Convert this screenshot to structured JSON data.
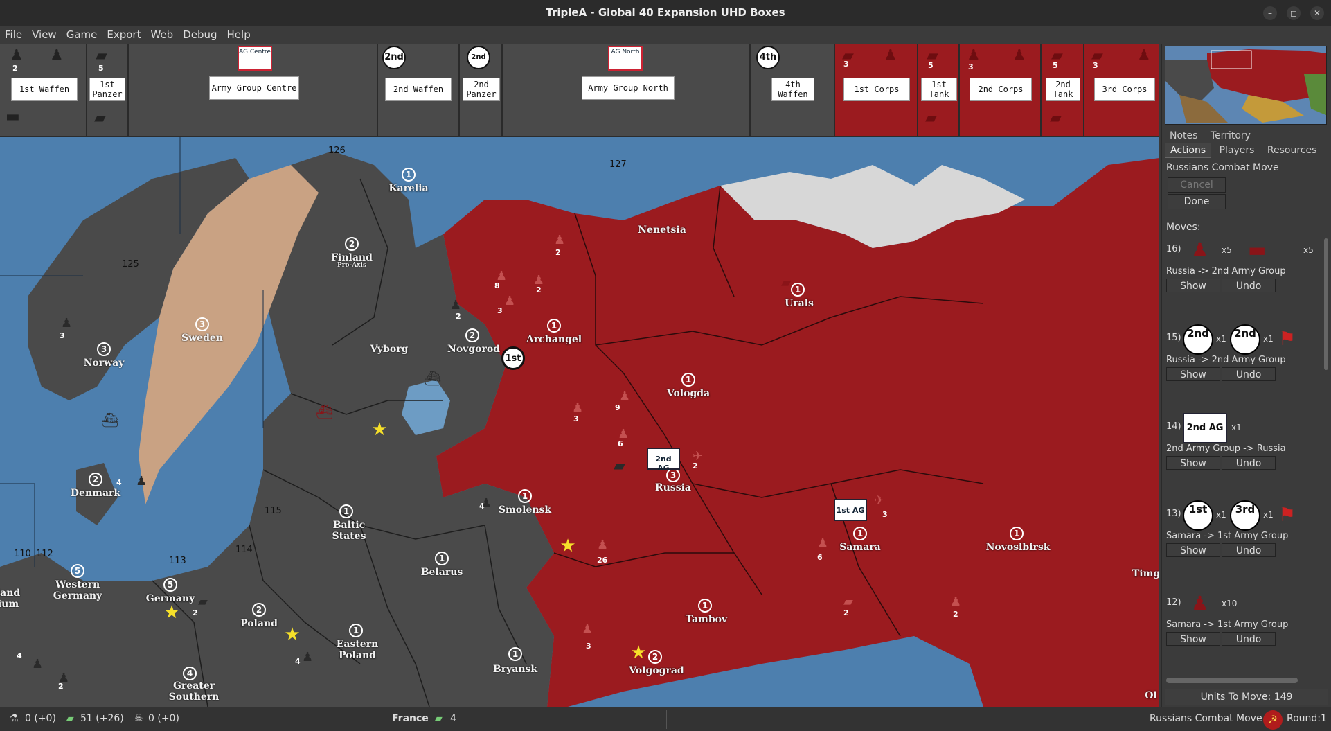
{
  "window": {
    "title": "TripleA - Global 40 Expansion UHD Boxes",
    "controls": [
      "–",
      "◻",
      "✕"
    ]
  },
  "menu": [
    "File",
    "View",
    "Game",
    "Export",
    "Web",
    "Debug",
    "Help"
  ],
  "unit_strip": {
    "groups": [
      {
        "labels": [
          "1st Waffen"
        ],
        "counts": [
          "2"
        ]
      },
      {
        "labels": [
          "1st Panzer"
        ],
        "counts": [
          "5"
        ]
      },
      {
        "labels": [
          "Army Group Centre"
        ],
        "badge": "AG Centre"
      },
      {
        "labels": [
          "2nd Waffen"
        ],
        "badge": "2nd"
      },
      {
        "labels": [
          "2nd Panzer"
        ],
        "badge": "2nd"
      },
      {
        "labels": [
          "Army Group North"
        ],
        "badge": "AG North"
      },
      {
        "labels": [
          "4th Waffen"
        ],
        "badge": "4th"
      },
      {
        "labels": [
          "1st Corps"
        ],
        "counts": [
          "3"
        ]
      },
      {
        "labels": [
          "1st Tank"
        ],
        "counts": [
          "5"
        ]
      },
      {
        "labels": [
          "2nd Corps"
        ],
        "counts": [
          "3"
        ]
      },
      {
        "labels": [
          "2nd Tank"
        ],
        "counts": [
          "5"
        ]
      },
      {
        "labels": [
          "3rd Corps"
        ],
        "counts": [
          "3"
        ]
      }
    ]
  },
  "map": {
    "sea_zones": [
      "126",
      "127",
      "125",
      "115",
      "110",
      "112",
      "113",
      "114"
    ],
    "territories": [
      {
        "name": "Karelia",
        "ipc": "1"
      },
      {
        "name": "Finland",
        "ipc": "2",
        "sub": "Pro-Axis"
      },
      {
        "name": "Sweden",
        "ipc": "3"
      },
      {
        "name": "Norway",
        "ipc": "3"
      },
      {
        "name": "Vyborg",
        "ipc": ""
      },
      {
        "name": "Novgorod",
        "ipc": "2"
      },
      {
        "name": "Archangel",
        "ipc": "1"
      },
      {
        "name": "Nenetsia",
        "ipc": ""
      },
      {
        "name": "Urals",
        "ipc": "1"
      },
      {
        "name": "Vologda",
        "ipc": "1"
      },
      {
        "name": "Russia",
        "ipc": "3"
      },
      {
        "name": "Denmark",
        "ipc": "2"
      },
      {
        "name": "Smolensk",
        "ipc": "1"
      },
      {
        "name": "Baltic States",
        "ipc": "1"
      },
      {
        "name": "Belarus",
        "ipc": "1"
      },
      {
        "name": "Western Germany",
        "ipc": "5"
      },
      {
        "name": "Germany",
        "ipc": "5"
      },
      {
        "name": "Poland",
        "ipc": "2"
      },
      {
        "name": "Eastern Poland",
        "ipc": "1"
      },
      {
        "name": "Samara",
        "ipc": "1"
      },
      {
        "name": "Novosibirsk",
        "ipc": "1"
      },
      {
        "name": "Tambov",
        "ipc": "1"
      },
      {
        "name": "Bryansk",
        "ipc": "1"
      },
      {
        "name": "Volgograd",
        "ipc": "2"
      },
      {
        "name": "Greater Southern",
        "ipc": "4"
      },
      {
        "name": "Timg",
        "ipc": ""
      },
      {
        "name": "Ol",
        "ipc": ""
      },
      {
        "name": "land",
        "ipc": ""
      },
      {
        "name": "ium",
        "ipc": ""
      }
    ],
    "markers": {
      "army_group_2nd": "2nd AG",
      "army_group_1st": "1st AG",
      "first": "1st"
    },
    "unit_counts": [
      "2",
      "8",
      "2",
      "3",
      "2",
      "1",
      "3",
      "9",
      "6",
      "2",
      "4",
      "3",
      "2",
      "26",
      "3",
      "6",
      "2",
      "2",
      "3",
      "4",
      "6",
      "4",
      "2",
      "2",
      "3",
      "4"
    ]
  },
  "panel": {
    "tabs_row1": [
      "Notes",
      "Territory"
    ],
    "tabs_row2": [
      "Actions",
      "Players",
      "Resources"
    ],
    "active_tab": "Actions",
    "phase": "Russians Combat Move",
    "cancel_label": "Cancel",
    "done_label": "Done",
    "moves_label": "Moves:",
    "moves": [
      {
        "num": "16)",
        "mult1": "x5",
        "mult2": "x5",
        "desc": "Russia -> 2nd Army Group",
        "badge1": "",
        "badge2": ""
      },
      {
        "num": "15)",
        "mult1": "x1",
        "mult2": "x1",
        "desc": "Russia -> 2nd Army Group",
        "badge1": "2nd",
        "badge2": "2nd"
      },
      {
        "num": "14)",
        "mult1": "x1",
        "mult2": "",
        "desc": "2nd Army Group -> Russia",
        "badge1": "2nd AG",
        "badge2": ""
      },
      {
        "num": "13)",
        "mult1": "x1",
        "mult2": "x1",
        "desc": "Samara -> 1st Army Group",
        "badge1": "1st",
        "badge2": "3rd"
      },
      {
        "num": "12)",
        "mult1": "x10",
        "mult2": "",
        "desc": "Samara -> 1st Army Group",
        "badge1": "",
        "badge2": ""
      }
    ],
    "show_label": "Show",
    "undo_label": "Undo",
    "units_to_move": "Units To Move: 149"
  },
  "status": {
    "tech": "0 (+0)",
    "pus": "51 (+26)",
    "other": "0 (+0)",
    "territory": "France",
    "territory_value": "4",
    "phase": "Russians Combat Move",
    "round": "Round:1"
  },
  "colors": {
    "soviet_red": "#9b1b1f",
    "axis_grey": "#4a4a4a",
    "sweden_tan": "#c9a283",
    "sea_blue": "#4d7fae",
    "ice": "#d7d7d7"
  }
}
